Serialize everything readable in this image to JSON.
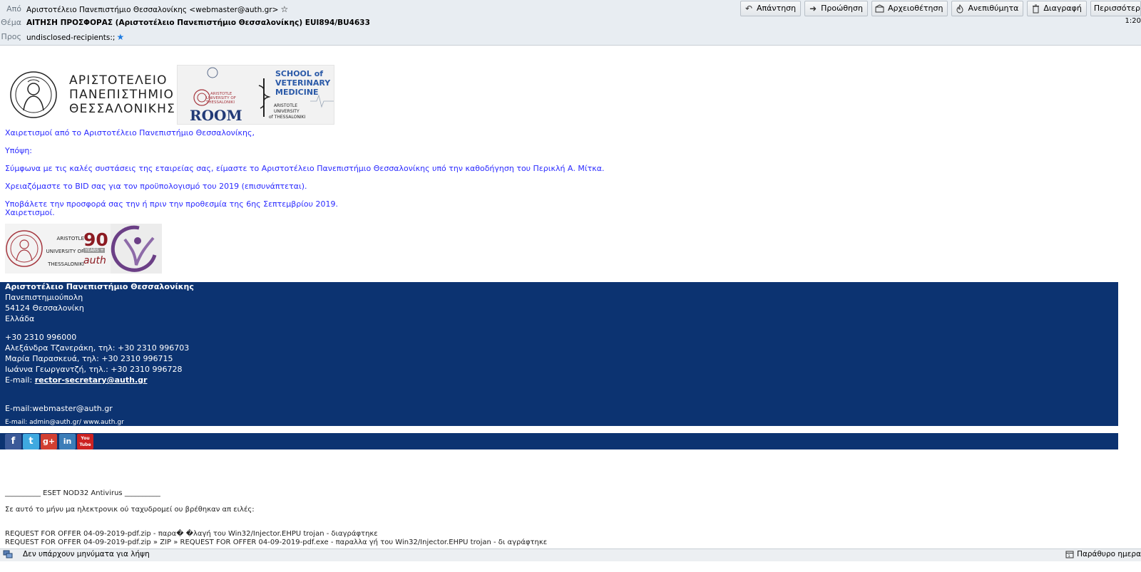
{
  "header": {
    "from_label": "Από",
    "from_value": "Αριστοτέλειο Πανεπιστήμιο Θεσσαλονίκης <webmaster@auth.gr>",
    "subject_label": "Θέμα",
    "subject_value": "ΑΙΤΗΣΗ ΠΡΟΣΦΟΡΑΣ (Αριστοτέλειο Πανεπιστήμιο Θεσσαλονίκης) EUI894/BU4633",
    "to_label": "Προς",
    "to_value": "undisclosed-recipients:;",
    "time": "1:20"
  },
  "toolbar": {
    "reply": "Απάντηση",
    "forward": "Προώθηση",
    "archive": "Αρχειοθέτηση",
    "junk": "Ανεπιθύμητα",
    "delete": "Διαγραφή",
    "more": "Περισσότερ"
  },
  "logos": {
    "auth_name_1": "ΑΡΙΣΤΟΤΕΛΕΙΟ",
    "auth_name_2": "ΠΑΝΕΠΙΣΤΗΜΙΟ",
    "auth_name_3": "ΘΕΣΣΑΛΟΝΙΚΗΣ",
    "room_1": "ARISTOTLE",
    "room_2": "UNIVERSITY OF",
    "room_3": "THESSALONIKI",
    "room_word": "ROOM",
    "vet_1": "SCHOOL of",
    "vet_2": "VETERINARY",
    "vet_3": "MEDICINE",
    "vet_4": "ARISTOTLE",
    "vet_5": "UNIVERSITY",
    "vet_6": "of THESSALONIKI"
  },
  "body": {
    "greeting": "Χαιρετισμοί από το Αριστοτέλειο Πανεπιστήμιο Θεσσαλονίκης,",
    "attention": "Υπόψη:",
    "p1": "Σύμφωνα με τις καλές συστάσεις της εταιρείας σας, είμαστε το Αριστοτέλειο Πανεπιστήμιο Θεσσαλονίκης υπό την καθοδήγηση του Περικλή Α. Μίτκα.",
    "p2": "Χρειαζόμαστε το BID σας για τον προϋπολογισμό του 2019 (επισυνάπτεται).",
    "p3": "Υποβάλετε την προσφορά σας την ή πριν την προθεσμία της 6ης Σεπτεμβρίου 2019.",
    "closing": "Χαιρετισμοί."
  },
  "small_logos": {
    "t1": "ARISTOTLE",
    "t2": "UNIVERSITY OF",
    "t3": "THESSALONIKI",
    "ninety": "90",
    "years": "YEARS +",
    "auth": "auth"
  },
  "signature": {
    "org": "Αριστοτέλειο Πανεπιστήμιο Θεσσαλονίκης",
    "addr1": "Πανεπιστημιούπολη",
    "addr2": "54124 Θεσσαλονίκη",
    "addr3": "Ελλάδα",
    "phone": "+30 2310 996000",
    "c1": "Αλεξάνδρα Τζανεράκη, τηλ: +30 2310 996703",
    "c2": "Μαρία Παρασκευά, τηλ: +30 2310 996715",
    "c3": "Ιωάννα Γεωργαντζή, τηλ.: +30 2310 996728",
    "email_label": "E-mail: ",
    "email_link": "rector-secretary@auth.gr",
    "webmaster": "E-mail:webmaster@auth.gr",
    "admin": "E-mail: admin@auth.gr/ www.auth.gr"
  },
  "social": {
    "fb": "f",
    "tw": "t",
    "gp": "g+",
    "li": "in",
    "yt": "You Tube"
  },
  "antivirus": {
    "title": "__________ ESET NOD32 Antivirus __________",
    "intro": "Σε αυτό το μήνυ μα ηλεκτρονικ ού ταχυδρομεί ου βρέθηκαν απ ειλές:",
    "line1": "REQUEST FOR OFFER 04-09-2019-pdf.zip - παρα� �λαγή του Win32/Injector.EHPU trojan - διαγράφτηκε",
    "line2": "REQUEST FOR OFFER 04-09-2019-pdf.zip » ZIP » REQUEST FOR OFFER 04-09-2019-pdf.exe - παραλλα γή του Win32/Injector.EHPU trojan - δι αγράφτηκε"
  },
  "status": {
    "text": "Δεν υπάρχουν μηνύματα για λήψη",
    "activity": "Παράθυρο ημερα"
  },
  "colors": {
    "signature_bg": "#0c3371",
    "link_blue": "#2a2aff",
    "header_bg": "#e8edf2"
  }
}
